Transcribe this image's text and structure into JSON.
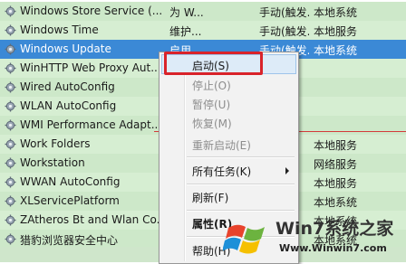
{
  "services": [
    {
      "name": "Windows Store Service (...",
      "description": "为 W...",
      "startup": "手动(触发...",
      "logon": "本地系统"
    },
    {
      "name": "Windows Time",
      "description": "维护...",
      "startup": "手动(触发...",
      "logon": "本地服务"
    },
    {
      "name": "Windows Update",
      "description": "启用 ...",
      "startup": "手动(触发...",
      "logon": "本地系统"
    },
    {
      "name": "WinHTTP Web Proxy Aut...",
      "description": "",
      "startup": "",
      "logon": ""
    },
    {
      "name": "Wired AutoConfig",
      "description": "",
      "startup": "",
      "logon": ""
    },
    {
      "name": "WLAN AutoConfig",
      "description": "",
      "startup": "",
      "logon": ""
    },
    {
      "name": "WMI Performance Adapt...",
      "description": "",
      "startup": "",
      "logon": ""
    },
    {
      "name": "Work Folders",
      "description": "",
      "startup": "",
      "logon": "本地服务"
    },
    {
      "name": "Workstation",
      "description": "",
      "startup": "",
      "logon": "网络服务"
    },
    {
      "name": "WWAN AutoConfig",
      "description": "",
      "startup": "",
      "logon": "本地服务"
    },
    {
      "name": "XLServicePlatform",
      "description": "",
      "startup": "",
      "logon": "本地系统"
    },
    {
      "name": "ZAtheros Bt and Wlan Co...",
      "description": "",
      "startup": "",
      "logon": "本地系统"
    },
    {
      "name": "猎豹浏览器安全中心",
      "description": "",
      "startup": "",
      "logon": "本地系统"
    }
  ],
  "selected_service": "Windows Update",
  "context_menu": {
    "items": [
      {
        "label": "启动(S)",
        "state": "highlighted"
      },
      {
        "label": "停止(O)",
        "state": "disabled"
      },
      {
        "label": "暂停(U)",
        "state": "disabled"
      },
      {
        "label": "恢复(M)",
        "state": "disabled"
      },
      {
        "label": "重新启动(E)",
        "state": "disabled"
      },
      {
        "label": "所有任务(K)",
        "state": "normal",
        "submenu": true
      },
      {
        "label": "刷新(F)",
        "state": "normal"
      },
      {
        "label": "属性(R)",
        "state": "bold"
      },
      {
        "label": "帮助(H)",
        "state": "normal"
      }
    ]
  },
  "watermark": {
    "title": "Win7系统之家",
    "url": "Www.Winwin7.com"
  },
  "colors": {
    "row_background": "#cde8c9",
    "selection": "#3b89d6",
    "highlight_box": "#d9232a"
  }
}
